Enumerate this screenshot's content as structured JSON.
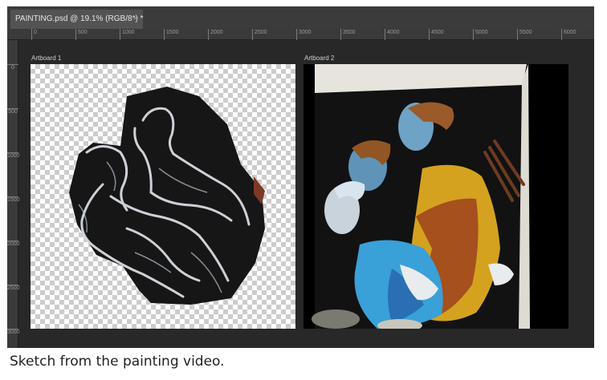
{
  "tab": {
    "title": "PAINTING.psd @ 19.1% (RGB/8*) *",
    "close_glyph": "×"
  },
  "ruler": {
    "horizontal": [
      "0",
      "500",
      "1000",
      "1500",
      "2000",
      "2500",
      "3000",
      "3500",
      "4000",
      "4500",
      "5000",
      "5500",
      "6000"
    ],
    "vertical": [
      "0",
      "500",
      "1000",
      "1500",
      "2000",
      "2500",
      "3000"
    ]
  },
  "artboards": [
    {
      "label": "Artboard 1"
    },
    {
      "label": "Artboard 2"
    }
  ],
  "caption": "Sketch from the painting video."
}
